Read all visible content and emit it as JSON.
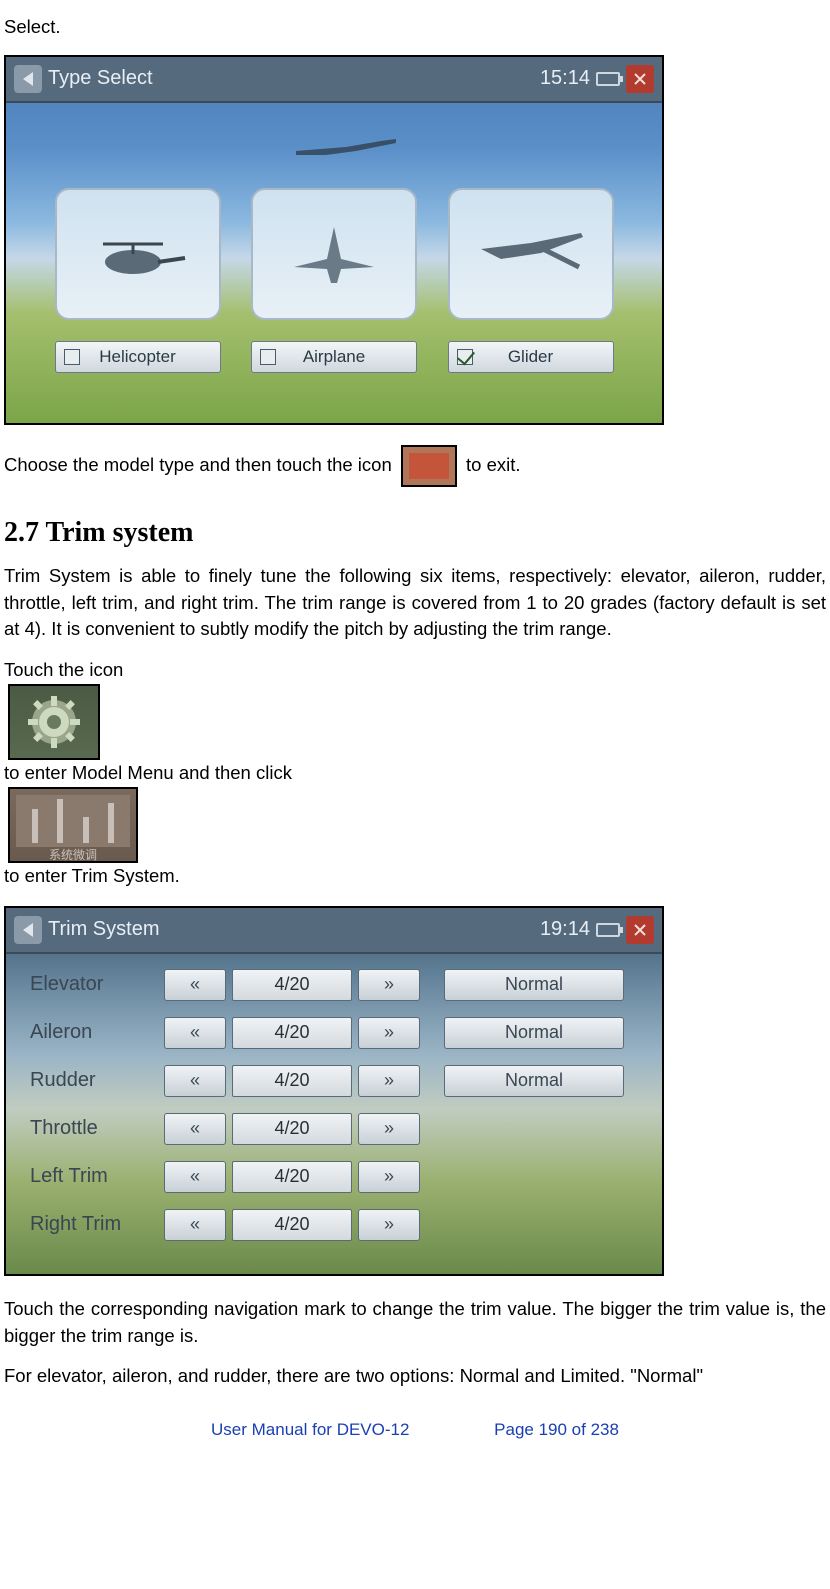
{
  "intro_line": "Select.",
  "fig1": {
    "title": "Type Select",
    "time": "15:14",
    "options": [
      {
        "label": "Helicopter",
        "checked": false
      },
      {
        "label": "Airplane",
        "checked": false
      },
      {
        "label": "Glider",
        "checked": true
      }
    ]
  },
  "para_choose_a": "Choose the model type and then touch the icon",
  "para_choose_b": "to exit.",
  "section_heading": "2.7 Trim system",
  "trim_intro": "Trim System is able to finely tune the following six items, respectively: elevator, aileron, rudder, throttle, left trim, and right trim. The trim range is covered from 1 to 20 grades (factory default is set at 4). It is convenient to subtly modify the pitch by adjusting the trim range.",
  "touch_a": "Touch the icon",
  "touch_b": "to enter Model Menu and then click",
  "touch_c": "to enter Trim System.",
  "trim_icon_caption": "系统微调",
  "fig2": {
    "title": "Trim System",
    "time": "19:14",
    "rows": [
      {
        "name": "Elevator",
        "value": "4/20",
        "mode": "Normal"
      },
      {
        "name": "Aileron",
        "value": "4/20",
        "mode": "Normal"
      },
      {
        "name": "Rudder",
        "value": "4/20",
        "mode": "Normal"
      },
      {
        "name": "Throttle",
        "value": "4/20",
        "mode": null
      },
      {
        "name": "Left Trim",
        "value": "4/20",
        "mode": null
      },
      {
        "name": "Right Trim",
        "value": "4/20",
        "mode": null
      }
    ]
  },
  "para_nav": "Touch the corresponding navigation mark to change the trim value. The bigger the trim value is, the bigger the trim range is.",
  "para_options": "For elevator, aileron, and rudder, there are two options: Normal and Limited. \"Normal\"",
  "footer": {
    "title": "User Manual for DEVO-12",
    "page": "Page 190 of 238"
  }
}
